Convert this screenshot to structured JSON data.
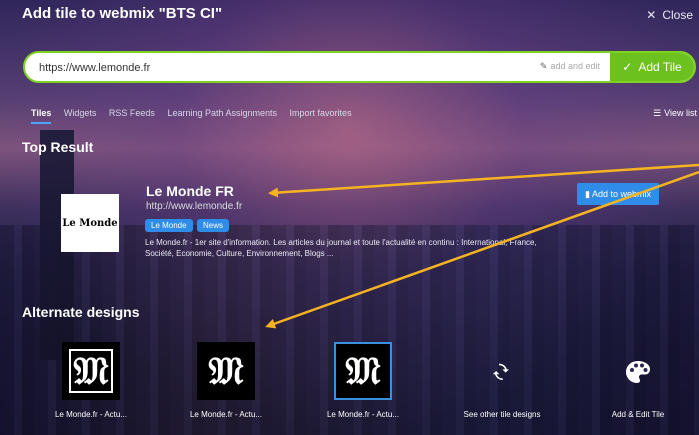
{
  "header": {
    "title": "Add tile to webmix \"BTS CI\"",
    "close_label": "Close"
  },
  "urlbar": {
    "value": "https://www.lemonde.fr",
    "add_and_edit_label": "add and edit",
    "add_tile_label": "Add Tile"
  },
  "tabs": [
    {
      "label": "Tiles",
      "active": true
    },
    {
      "label": "Widgets",
      "active": false
    },
    {
      "label": "RSS Feeds",
      "active": false
    },
    {
      "label": "Learning Path Assignments",
      "active": false
    },
    {
      "label": "Import favorites",
      "active": false
    }
  ],
  "view_list_label": "View list",
  "top_result": {
    "section_title": "Top Result",
    "logo_text": "Le Monde",
    "title": "Le Monde FR",
    "url": "http://www.lemonde.fr",
    "tags": [
      "Le Monde",
      "News"
    ],
    "description": "Le Monde.fr - 1er site d'information. Les articles du journal et toute l'actualité en continu : International, France, Société, Economie, Culture, Environnement, Blogs ...",
    "add_button_label": "Add to webmix"
  },
  "alternate": {
    "section_title": "Alternate designs",
    "designs": [
      {
        "label": "Le Monde.fr - Actu...",
        "style": "white-frame"
      },
      {
        "label": "Le Monde.fr - Actu...",
        "style": "black"
      },
      {
        "label": "Le Monde.fr - Actu...",
        "style": "blue-frame"
      }
    ],
    "more_label": "See other tile designs",
    "edit_label": "Add & Edit Tile"
  },
  "colors": {
    "accent_green": "#6cc11f",
    "accent_blue": "#2f8ce8",
    "arrow_orange": "#f5b321"
  }
}
